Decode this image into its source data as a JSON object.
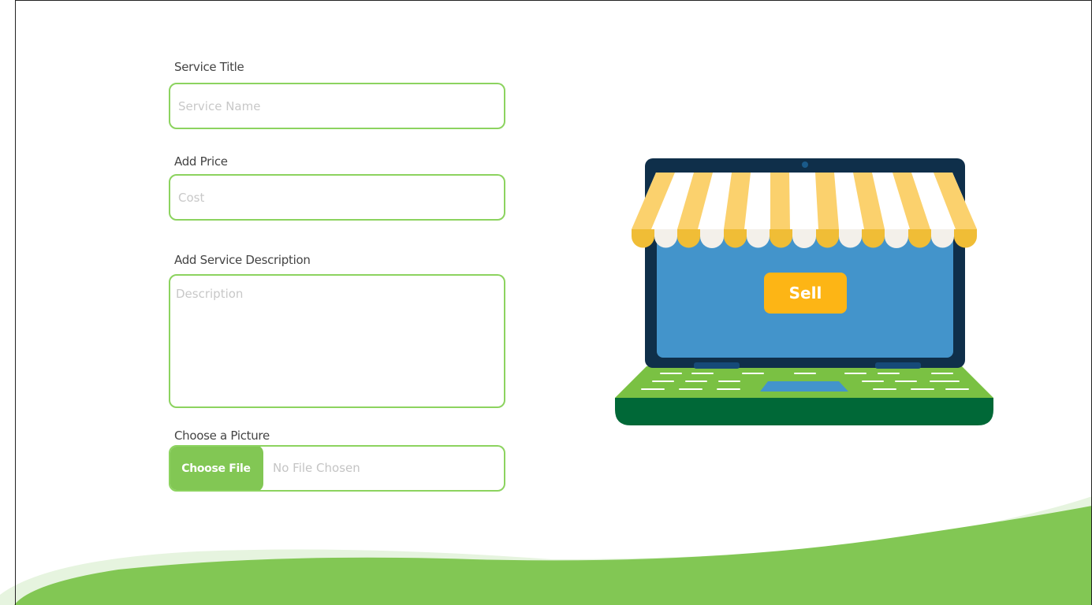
{
  "form": {
    "title_label": "Service Title",
    "title_placeholder": "Service Name",
    "price_label": "Add Price",
    "price_placeholder": "Cost",
    "description_label": "Add Service Description",
    "description_placeholder": "Description",
    "picture_label": "Choose a Picture",
    "choose_file_label": "Choose File",
    "file_status": "No File Chosen"
  },
  "illustration": {
    "sell_label": "Sell"
  },
  "colors": {
    "accent_green": "#82c754",
    "field_border": "#8cd35f",
    "dark_green": "#006837",
    "screen_blue": "#4394cb",
    "frame_navy": "#0f2f4a",
    "awning_yellow": "#fbd16d",
    "sell_orange": "#fdb515"
  }
}
